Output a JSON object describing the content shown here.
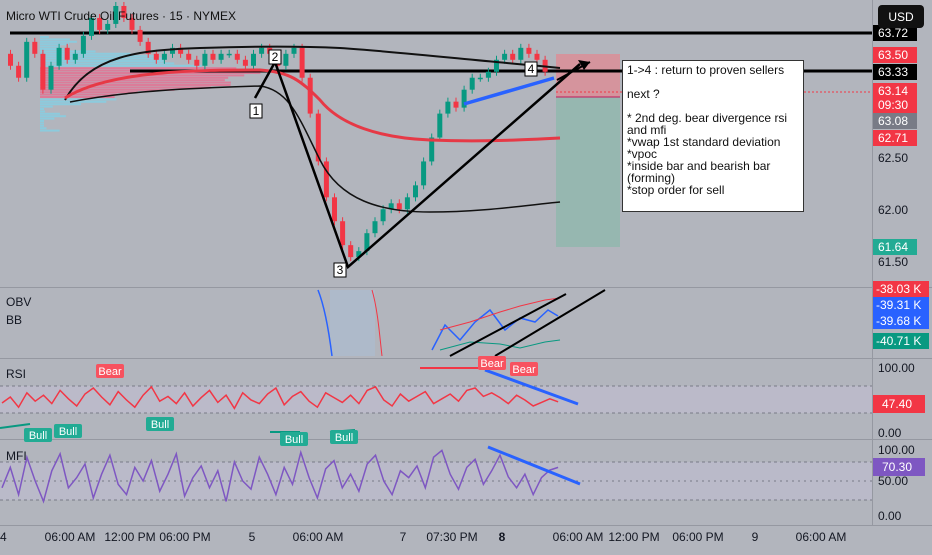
{
  "header": {
    "title": "Micro WTI Crude Oil Futures · 15 · NYMEX",
    "currency_label": "USD"
  },
  "note": {
    "lines": [
      "1->4 : return to proven sellers",
      "",
      "next ?",
      "",
      "* 2nd deg. bear divergence rsi and mfi",
      "*vwap 1st standard deviation",
      "*vpoc",
      "*inside bar and bearish bar (forming)",
      "*stop order for sell"
    ]
  },
  "wave_labels": [
    "1",
    "2",
    "3",
    "4"
  ],
  "chart_data": [
    {
      "type": "line",
      "panel": "price",
      "y_ticks": [
        "62.50",
        "62.00",
        "61.50"
      ],
      "y_range": [
        61.35,
        63.75
      ],
      "price_badges": [
        {
          "label": "63.72",
          "bg": "#000000",
          "fg": "#ffffff"
        },
        {
          "label": "63.50",
          "bg": "#f23645",
          "fg": "#ffffff"
        },
        {
          "label": "63.33",
          "bg": "#000000",
          "fg": "#ffffff"
        },
        {
          "label": "63.14",
          "bg": "#f23645",
          "fg": "#ffffff"
        },
        {
          "label": "09:30",
          "bg": "#f23645",
          "fg": "#ffffff"
        },
        {
          "label": "63.08",
          "bg": "#787b86",
          "fg": "#ffffff"
        },
        {
          "label": "62.71",
          "bg": "#f23645",
          "fg": "#ffffff"
        },
        {
          "label": "61.64",
          "bg": "#22ab94",
          "fg": "#ffffff"
        }
      ],
      "horizontal_levels": [
        63.72,
        63.33
      ],
      "wave_points": [
        {
          "label": "1",
          "price": 62.95
        },
        {
          "label": "2",
          "price": 63.45
        },
        {
          "label": "3",
          "price": 61.58
        },
        {
          "label": "4",
          "price": 63.38
        }
      ],
      "trade_box": {
        "entry": 63.14,
        "stop": 63.5,
        "target": 61.64
      },
      "price_series": [
        63.3,
        63.2,
        63.1,
        63.4,
        63.3,
        63.0,
        63.2,
        63.35,
        63.25,
        63.3,
        63.45,
        63.6,
        63.5,
        63.55,
        63.7,
        63.6,
        63.5,
        63.4,
        63.3,
        63.25,
        63.3,
        63.35,
        63.3,
        63.25,
        63.2,
        63.3,
        63.25,
        63.3,
        63.3,
        63.25,
        63.2,
        63.3,
        63.35,
        63.3,
        63.2,
        63.3,
        63.35,
        63.1,
        62.8,
        62.4,
        62.1,
        61.9,
        61.7,
        61.6,
        61.65,
        61.8,
        61.9,
        62.0,
        62.05,
        62.0,
        62.1,
        62.2,
        62.4,
        62.6,
        62.8,
        62.9,
        62.85,
        63.0,
        63.1,
        63.1,
        63.15,
        63.25,
        63.3,
        63.25,
        63.35,
        63.3,
        63.25,
        63.15
      ]
    },
    {
      "type": "line",
      "panel": "OBV",
      "title": "OBV",
      "subtitle": "BB",
      "value_badges": [
        {
          "label": "-38.03 K",
          "bg": "#f23645"
        },
        {
          "label": "-39.31 K",
          "bg": "#2962ff"
        },
        {
          "label": "-39.68 K",
          "bg": "#2962ff"
        },
        {
          "label": "-40.71 K",
          "bg": "#089981"
        }
      ]
    },
    {
      "type": "line",
      "panel": "RSI",
      "title": "RSI",
      "y_ticks": [
        "100.00",
        "0.00"
      ],
      "current_value": "47.40",
      "signals": [
        {
          "label": "Bear",
          "kind": "bear"
        },
        {
          "label": "Bear",
          "kind": "bear"
        },
        {
          "label": "Bear",
          "kind": "bear"
        },
        {
          "label": "Bull",
          "kind": "bull"
        },
        {
          "label": "Bull",
          "kind": "bull"
        },
        {
          "label": "Bull",
          "kind": "bull"
        },
        {
          "label": "Bull",
          "kind": "bull"
        },
        {
          "label": "Bull",
          "kind": "bull"
        }
      ],
      "values": [
        45,
        55,
        38,
        62,
        48,
        58,
        44,
        66,
        52,
        40,
        60,
        70,
        55,
        42,
        64,
        50,
        38,
        58,
        72,
        48,
        56,
        44,
        62,
        40,
        54,
        66,
        46,
        58,
        36,
        62,
        50,
        44,
        60,
        70,
        42,
        56,
        64,
        48,
        38,
        62,
        54,
        46,
        58,
        44,
        66,
        72,
        50,
        40,
        60,
        48,
        56,
        64,
        44,
        52,
        60,
        48,
        66,
        70,
        56,
        62,
        54,
        44,
        58,
        50,
        40,
        46,
        52,
        47
      ]
    },
    {
      "type": "line",
      "panel": "MFI",
      "title": "MFI",
      "y_ticks": [
        "100.00",
        "50.00",
        "0.00"
      ],
      "current_value": "70.30",
      "values": [
        40,
        70,
        30,
        85,
        50,
        20,
        65,
        90,
        40,
        55,
        75,
        25,
        60,
        88,
        45,
        30,
        70,
        50,
        80,
        35,
        60,
        90,
        28,
        55,
        72,
        40,
        65,
        20,
        78,
        50,
        38,
        85,
        60,
        30,
        70,
        45,
        92,
        55,
        25,
        68,
        80,
        40,
        60,
        35,
        75,
        88,
        50,
        30,
        65,
        55,
        72,
        40,
        85,
        95,
        60,
        38,
        70,
        82,
        45,
        65,
        88,
        56,
        40,
        60,
        30,
        55,
        66,
        70
      ]
    }
  ],
  "x_axis_labels": [
    "4",
    "06:00 AM",
    "12:00 PM",
    "06:00 PM",
    "5",
    "06:00 AM",
    "7",
    "07:30 PM",
    "8",
    "06:00 AM",
    "12:00 PM",
    "06:00 PM",
    "9",
    "06:00 AM"
  ]
}
